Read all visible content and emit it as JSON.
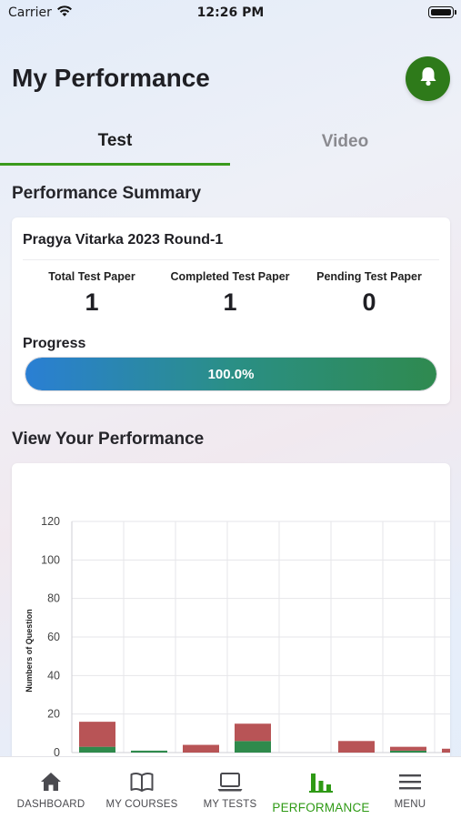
{
  "status_bar": {
    "carrier": "Carrier",
    "time": "12:26 PM",
    "icons": [
      "wifi-icon",
      "battery-icon"
    ]
  },
  "header": {
    "title": "My Performance",
    "notification_icon": "bell-icon",
    "accent_color": "#2e7a1a"
  },
  "tabs": [
    {
      "label": "Test",
      "active": true
    },
    {
      "label": "Video",
      "active": false
    }
  ],
  "summary": {
    "section_title": "Performance Summary",
    "test_name": "Pragya Vitarka 2023 Round-1",
    "stats": [
      {
        "label": "Total Test Paper",
        "value": "1"
      },
      {
        "label": "Completed Test Paper",
        "value": "1"
      },
      {
        "label": "Pending Test Paper",
        "value": "0"
      }
    ],
    "progress_label": "Progress",
    "progress_text": "100.0%",
    "progress_fraction": 1.0
  },
  "performance": {
    "section_title": "View Your Performance"
  },
  "chart_data": {
    "type": "bar",
    "ylabel": "Numbers of Question",
    "ylim": [
      0,
      120
    ],
    "yticks": [
      0,
      20,
      40,
      60,
      80,
      100,
      120
    ],
    "grid": true,
    "stacked": true,
    "series": [
      {
        "color": "#2f8a4c",
        "values": [
          3,
          1,
          0,
          6,
          0,
          0,
          1,
          0
        ]
      },
      {
        "color": "#b85456",
        "values": [
          13,
          0,
          4,
          9,
          0,
          6,
          2,
          2
        ]
      }
    ]
  },
  "bottom_nav": [
    {
      "label": "DASHBOARD",
      "icon": "home-icon",
      "active": false
    },
    {
      "label": "MY COURSES",
      "icon": "book-icon",
      "active": false
    },
    {
      "label": "MY TESTS",
      "icon": "laptop-icon",
      "active": false
    },
    {
      "label": "PERFORMANCE",
      "icon": "bar-chart-icon",
      "active": true
    },
    {
      "label": "MENU",
      "icon": "menu-icon",
      "active": false
    }
  ],
  "colors": {
    "active_green": "#2f9a15",
    "tab_indicator": "#3a9a1c"
  }
}
